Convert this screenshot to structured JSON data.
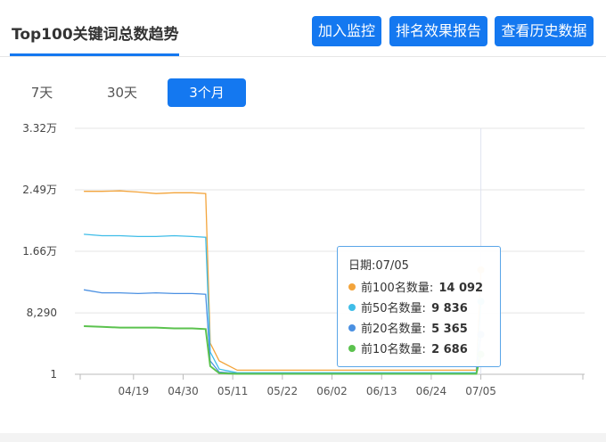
{
  "header": {
    "title": "Top100关键词总数趋势",
    "buttons": {
      "monitor": "加入监控",
      "report": "排名效果报告",
      "history": "查看历史数据"
    }
  },
  "range_tabs": [
    {
      "label": "7天",
      "active": false
    },
    {
      "label": "30天",
      "active": false
    },
    {
      "label": "3个月",
      "active": true
    }
  ],
  "colors": {
    "accent": "#1478f0",
    "top100": "#f3a43b",
    "top50": "#3fbde8",
    "top20": "#4a90e2",
    "top10": "#5bc24e"
  },
  "tooltip": {
    "date_label": "日期:",
    "date": "07/05",
    "rows": [
      {
        "name": "前100名数量",
        "value": "14 092"
      },
      {
        "name": "前50名数量",
        "value": "9 836"
      },
      {
        "name": "前20名数量",
        "value": "5 365"
      },
      {
        "name": "前10名数量",
        "value": "2 686"
      }
    ]
  },
  "chart_data": {
    "type": "line",
    "y_ticks": [
      {
        "value": 1,
        "label": "1"
      },
      {
        "value": 8290,
        "label": "8,290"
      },
      {
        "value": 16600,
        "label": "1.66万"
      },
      {
        "value": 24900,
        "label": "2.49万"
      },
      {
        "value": 33200,
        "label": "3.32万"
      }
    ],
    "ylim": [
      1,
      33200
    ],
    "x_ticks": [
      "04/19",
      "04/30",
      "05/11",
      "05/22",
      "06/02",
      "06/13",
      "06/24",
      "07/05"
    ],
    "x": [
      "04/08",
      "04/12",
      "04/16",
      "04/20",
      "04/24",
      "04/28",
      "05/02",
      "05/05",
      "05/06",
      "05/08",
      "05/12",
      "05/18",
      "05/24",
      "05/30",
      "06/05",
      "06/11",
      "06/17",
      "06/23",
      "06/29",
      "07/04",
      "07/05"
    ],
    "series": [
      {
        "name": "前100名数量",
        "color": "#f3a43b",
        "values": [
          24700,
          24700,
          24750,
          24600,
          24400,
          24500,
          24500,
          24400,
          4200,
          1800,
          550,
          550,
          550,
          550,
          550,
          550,
          550,
          550,
          550,
          550,
          14092
        ]
      },
      {
        "name": "前50名数量",
        "color": "#3fbde8",
        "values": [
          18900,
          18700,
          18700,
          18600,
          18600,
          18700,
          18600,
          18500,
          3000,
          700,
          200,
          200,
          200,
          200,
          200,
          200,
          200,
          200,
          200,
          200,
          9836
        ]
      },
      {
        "name": "前20名数量",
        "color": "#4a90e2",
        "values": [
          11400,
          11000,
          11000,
          10900,
          11000,
          10900,
          10900,
          10800,
          1800,
          300,
          120,
          120,
          120,
          120,
          120,
          120,
          120,
          120,
          120,
          120,
          5365
        ]
      },
      {
        "name": "前10名数量",
        "color": "#5bc24e",
        "values": [
          6500,
          6400,
          6300,
          6300,
          6300,
          6200,
          6200,
          6100,
          1100,
          150,
          60,
          60,
          60,
          60,
          60,
          60,
          60,
          60,
          60,
          60,
          2686
        ]
      }
    ],
    "grid": true,
    "legend": "none"
  }
}
